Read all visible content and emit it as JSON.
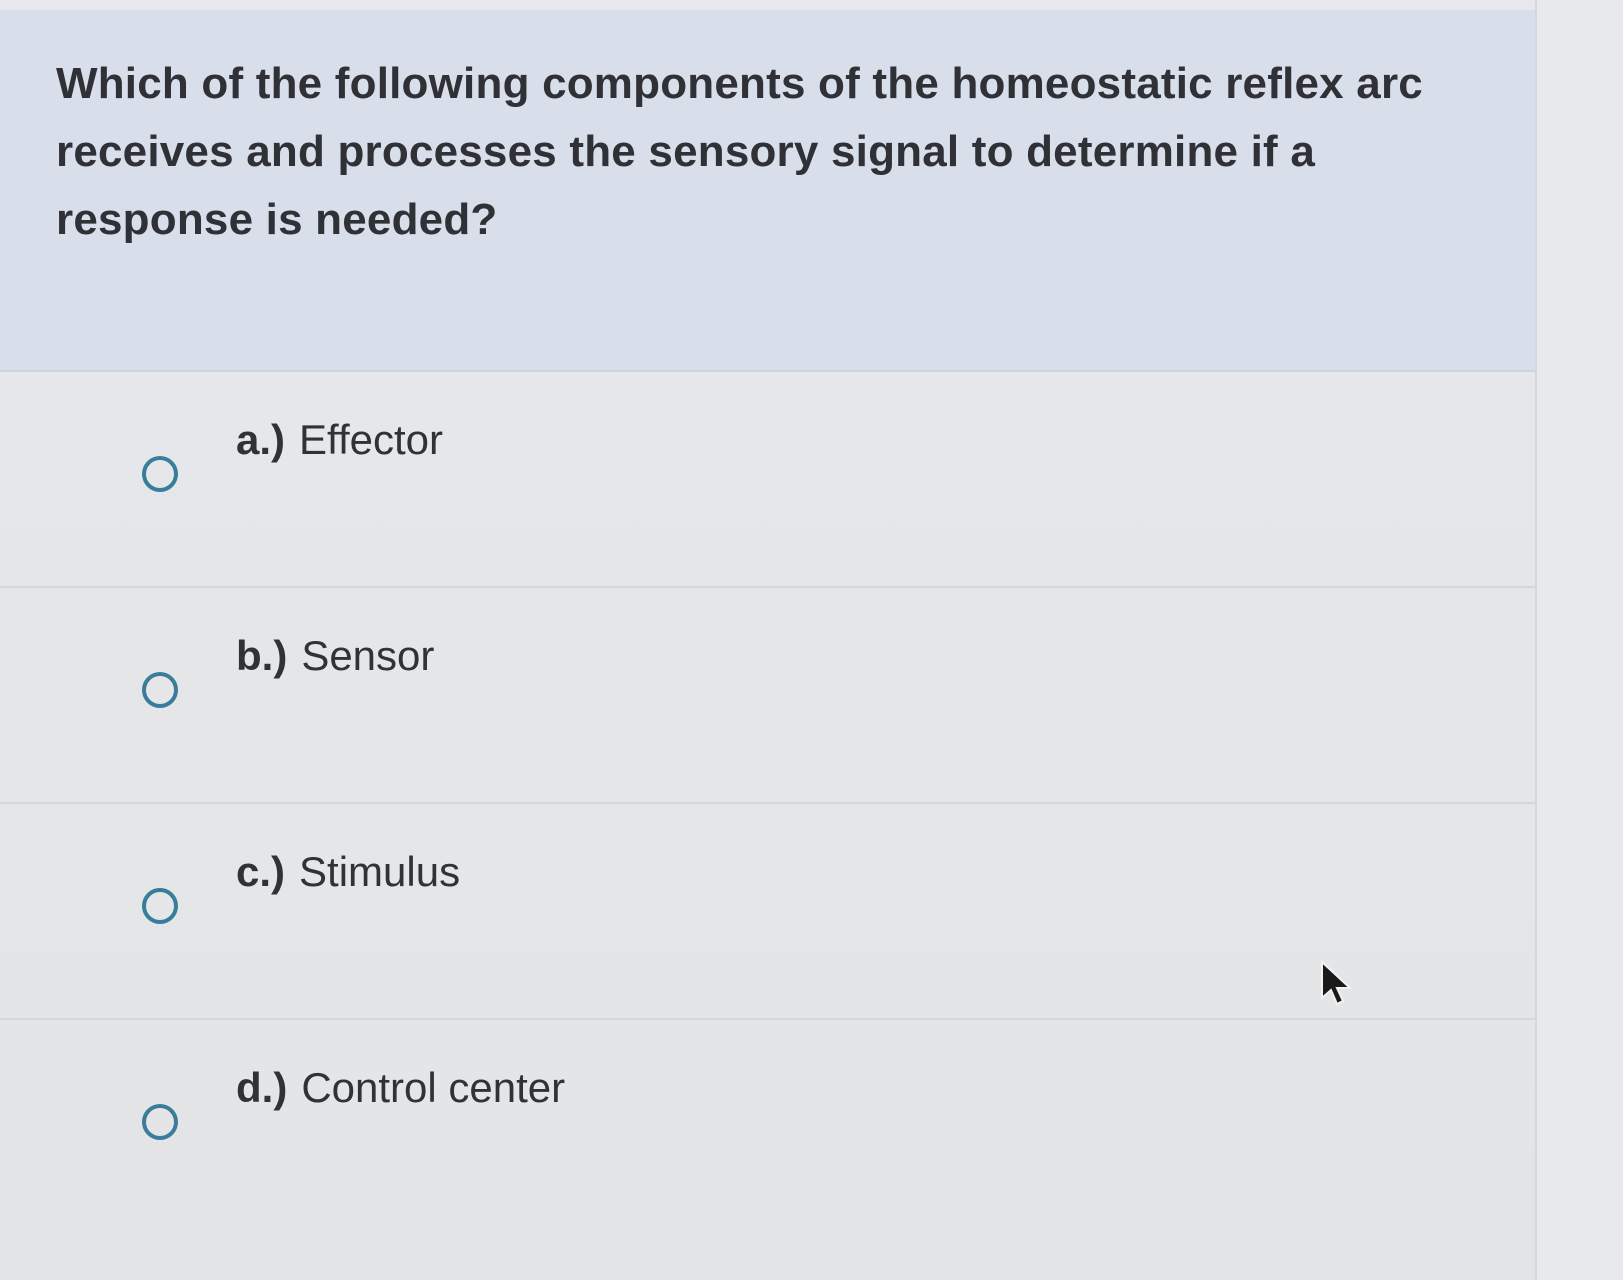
{
  "question": {
    "text": "Which of the following components of the homeostatic reflex arc receives and processes the sensory signal to determine if a response is needed?"
  },
  "options": [
    {
      "letter": "a.)",
      "text": "Effector"
    },
    {
      "letter": "b.)",
      "text": "Sensor"
    },
    {
      "letter": "c.)",
      "text": "Stimulus"
    },
    {
      "letter": "d.)",
      "text": "Control center"
    }
  ],
  "colors": {
    "question_background": "#d9dfea",
    "radio_border": "#3a7d9a",
    "text": "#303236"
  },
  "icons": {
    "radio": "radio-unselected-icon",
    "cursor": "mouse-pointer-icon"
  }
}
